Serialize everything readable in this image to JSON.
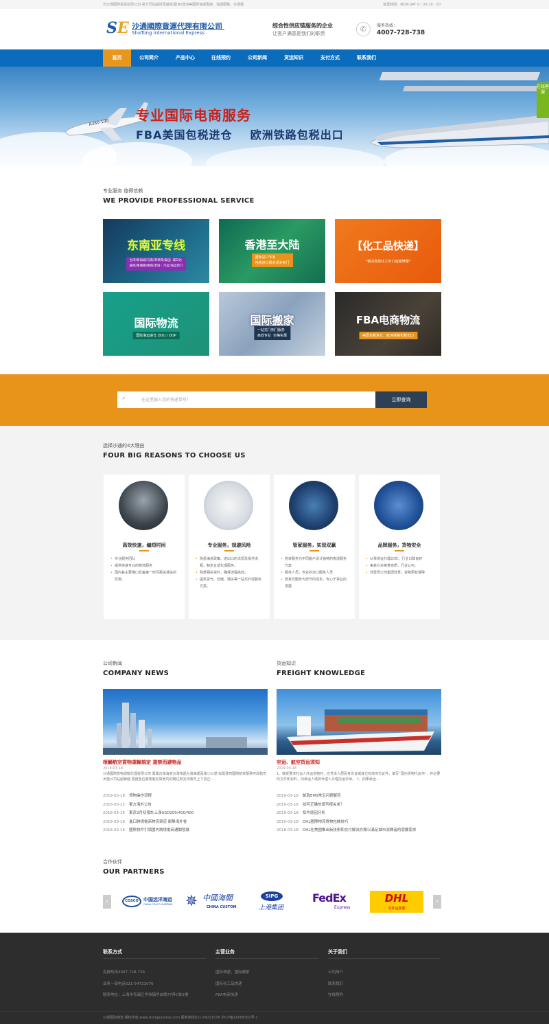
{
  "topbar": {
    "left": "司沙通國際貨運有限公司-常方同站提供至越南/歐洲/澳洲等國際海運專線，海運服務，空運報",
    "right": "營業時間：MON-SAT 9：00-18：00"
  },
  "header": {
    "logo_mark_s": "S",
    "logo_mark_e": "E",
    "logo_cn": "沙通國際貨運代理有限公司",
    "logo_en": "ShaTong International Express",
    "slogan_main": "综合性供应链服务的企业",
    "slogan_sub": "让客户满意是我们的职责",
    "hotline_label": "服务热线：",
    "hotline": "4007-728-738"
  },
  "nav": {
    "items": [
      "首页",
      "公司简介",
      "产品中心",
      "在线预约",
      "公司新闻",
      "货运知识",
      "支付方式",
      "联系我们"
    ],
    "active": 0
  },
  "banner": {
    "title": "专业国际电商服务",
    "subtitle": "FBA美国包税进仓    欧洲铁路包税出口",
    "plane_text": "A380-100",
    "side_tab": "在线客服"
  },
  "services": {
    "heading_cn": "专业服务 值得信赖",
    "heading_en": "WE PROVIDE PROFESSIONAL SERVICE",
    "tiles": [
      {
        "title": "东南亚专线",
        "sub": "台湾/新加坡/马来/菲律宾/泰国  城日达\n越南/柬埔寨/缅甸/老挝 · 汽运/海运到门"
      },
      {
        "title": "香港至大陆",
        "sub": "国际进口专家\n包税进口报关清关到门"
      },
      {
        "title": "【化工品快递】",
        "sub": "*解决您的化工出口运输难题*"
      },
      {
        "title": "国际物流",
        "sub": "国际海运进仓 DDU / DDP"
      },
      {
        "title": "国际搬家",
        "sub": "一站式门到门服务\n高效专业  价格实惠"
      },
      {
        "title": "FBA电商物流",
        "sub": "美国包税进仓、欧洲铁路包税出口"
      }
    ]
  },
  "search": {
    "placeholder": "在这里输入您的快递单号！",
    "button": "立即查询"
  },
  "reasons": {
    "heading_cn": "选择沙通的4大理由",
    "heading_en": "FOUR BIG REASONS TO CHOOSE US",
    "cards": [
      {
        "title": "高效快速，编短时间",
        "items": [
          "专业服务团队",
          "提供快速专业的物流服务",
          "国内各主要港口具备第一时间报关通关的优势。"
        ]
      },
      {
        "title": "专业服务，规避风险",
        "items": [
          "熟悉海关政策、进出口的法规及操作流程，制定合适化理服务。",
          "熟悉相关资料，确保流程高效。",
          "提供货代、仓储、通关等一站式外贸服务方案。"
        ]
      },
      {
        "title": "管家服务，实现双赢",
        "items": [
          "管家服务为不同客户设计独特的物流服务方案",
          "服务人员，专业的对口服务人员",
          "管家式服务为您节约成本，专心于事业的发展"
        ]
      },
      {
        "title": "品牌服务，货物安全",
        "items": [
          "从事货运代理20年，行业口碑良好",
          "来获众多荣誉资质，行业认可。",
          "背靠母公司集团背景，货物更有保障"
        ]
      }
    ]
  },
  "news": {
    "heading_cn": "公司新闻",
    "heading_en": "COMPANY NEWS",
    "feature_title": "根鰤航空貨物運輸規定 違禁而避物品",
    "feature_date": "2019-03-18",
    "feature_desc": "沙通國際貨物運輸代理有限公司 專業台灣海家台灣快遞台灣海運兩岸小三通 如需我司國際航家服務可與我司大陸公司站起聯絡 感謝各位廣泰朋友對我司的關注和支持我司上下真正...",
    "list": [
      {
        "date": "2019-03-18",
        "title": "貨物操作流程"
      },
      {
        "date": "2018-03-22",
        "title": "東方海外公告"
      },
      {
        "date": "2018-03-16",
        "title": "東京3月初預計上漲USD200/400/400"
      },
      {
        "date": "2018-03-16",
        "title": "進口跨境電商物流渠道 衝擊海外會"
      },
      {
        "date": "2018-03-16",
        "title": "國際快件引領國內跨境電商通關發展"
      }
    ]
  },
  "knowledge": {
    "heading_cn": "货运知识",
    "heading_en": "FREIGHT KNOWLEDGE",
    "feature_title": "空运、航空货运须知",
    "feature_date": "2019-03-18",
    "feature_desc": "1、接受要求托运人托运货物时，应凭本人居民身份证或其它有效身份证件，填写“国内货物托运书”，并必要的文件和资料，向承运人或其代理人办理托运手续。 2、如果承运...",
    "list": [
      {
        "date": "2019-03-18",
        "title": "邮政EMS常见问题解答"
      },
      {
        "date": "2019-03-18",
        "title": "如何正确的填写报关单？"
      },
      {
        "date": "2019-03-18",
        "title": "扣件原因分析"
      },
      {
        "date": "2019-03-18",
        "title": "DHL國際物流貨物包裝技巧"
      },
      {
        "date": "2018-03-18",
        "title": "DHL在美國推出新技術和交付解決方案以滿足城市消費者的需要需求"
      }
    ]
  },
  "partners": {
    "heading_cn": "合作伙伴",
    "heading_en": "OUR PARTNERS",
    "logos": [
      {
        "name": "COSCO",
        "cn": "中国远洋海运",
        "en": "CHINA COSCO SHIPPING"
      },
      {
        "name": "中國海關",
        "en": "CHINA CUSTOM"
      },
      {
        "name": "SIPG",
        "cn": "上港集团"
      },
      {
        "name": "FedEx",
        "sub": "Express"
      },
      {
        "name": "DHL",
        "cn": "中外运敦豪"
      }
    ]
  },
  "footer": {
    "col1": {
      "title": "联系方式",
      "items": [
        "免费热线4007-728-738",
        "业务一部电话021-54721076",
        "联系地址：上海市青浦区华徐镇华友路77弄C栋1楼"
      ]
    },
    "col2": {
      "title": "主营业务",
      "items": [
        "国际快递、国际搬家",
        "国际化工品快递",
        "FBA电商快递"
      ]
    },
    "col3": {
      "title": "关于我们",
      "items": [
        "公司简介",
        "联系我们",
        "在线预约"
      ]
    },
    "copyright": "沙通国际物流  版权所有 www.stongexpress.com 服务热线021-54721076 沪ICP备16008302号-1"
  }
}
